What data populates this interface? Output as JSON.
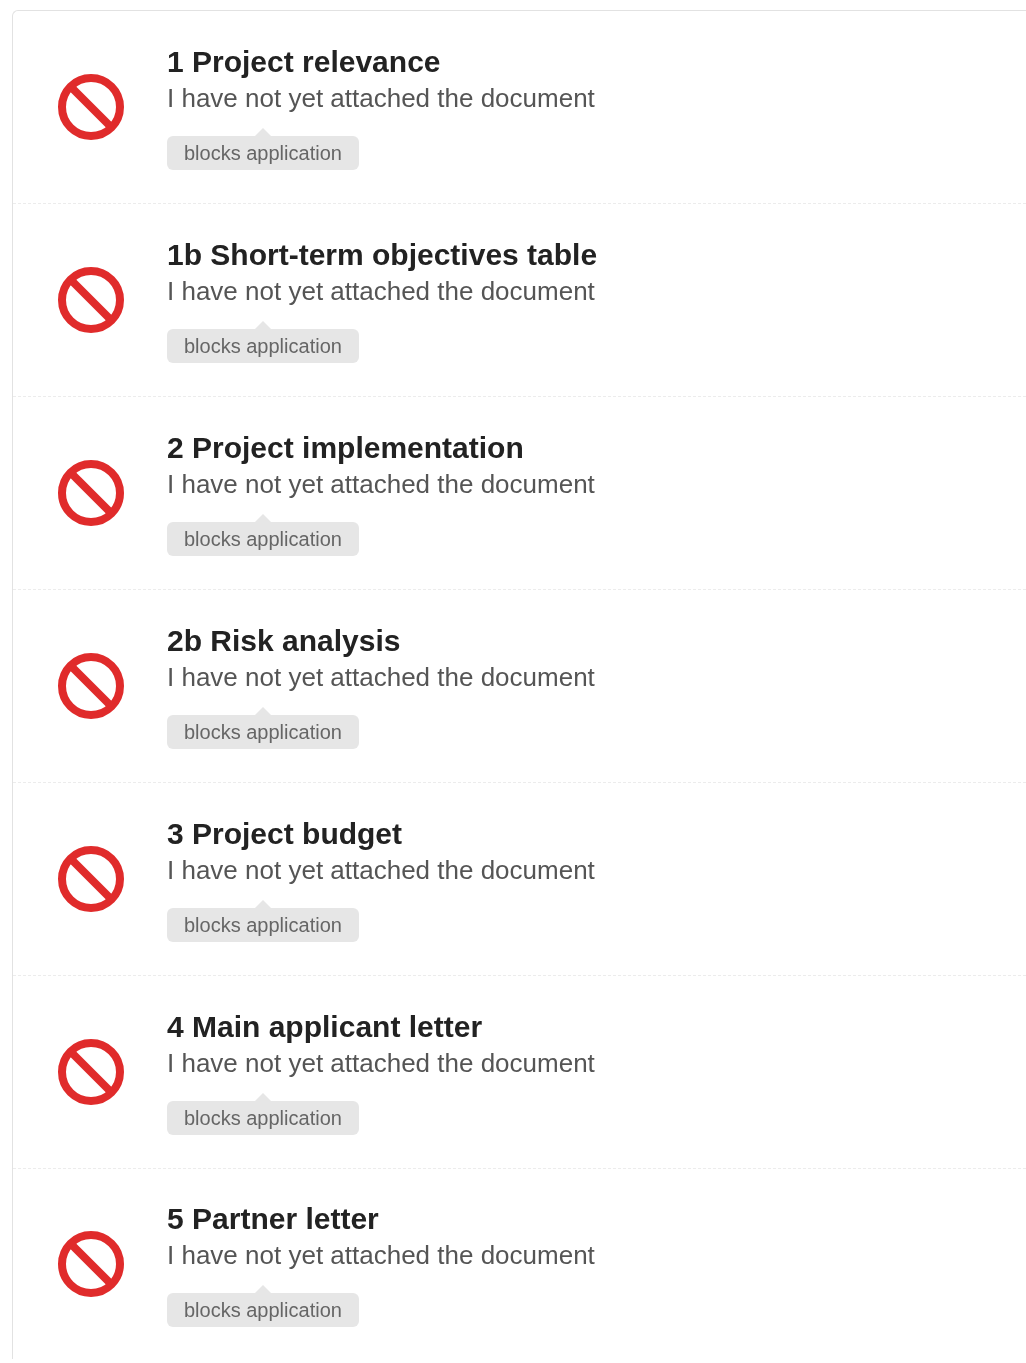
{
  "documents": [
    {
      "title": "1 Project relevance",
      "status": "I have not yet attached the document",
      "tag": "blocks application"
    },
    {
      "title": "1b Short-term objectives table",
      "status": "I have not yet attached the document",
      "tag": "blocks application"
    },
    {
      "title": "2 Project implementation",
      "status": "I have not yet attached the document",
      "tag": "blocks application"
    },
    {
      "title": "2b Risk analysis",
      "status": "I have not yet attached the document",
      "tag": "blocks application"
    },
    {
      "title": "3 Project budget",
      "status": "I have not yet attached the document",
      "tag": "blocks application"
    },
    {
      "title": "4 Main applicant letter",
      "status": "I have not yet attached the document",
      "tag": "blocks application"
    },
    {
      "title": "5 Partner letter",
      "status": "I have not yet attached the document",
      "tag": "blocks application"
    }
  ]
}
